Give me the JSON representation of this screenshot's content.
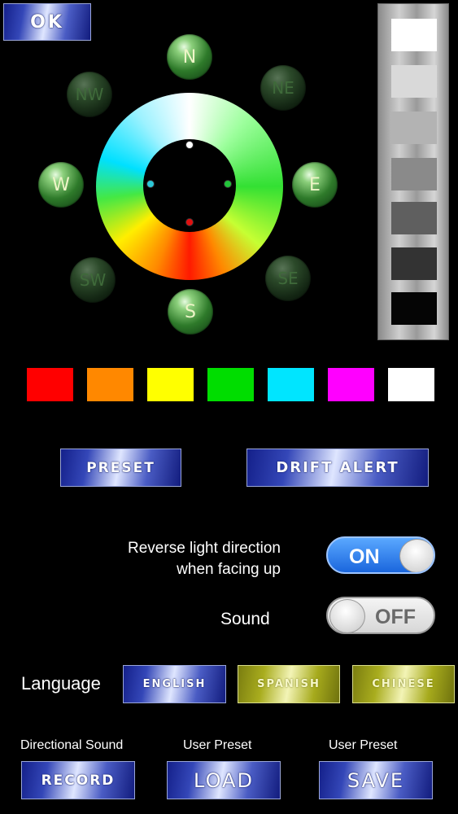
{
  "top": {
    "ok_label": "OK"
  },
  "compass": {
    "directions": {
      "n": "N",
      "ne": "NE",
      "e": "E",
      "se": "SE",
      "s": "S",
      "sw": "SW",
      "w": "W",
      "nw": "NW"
    }
  },
  "colors": {
    "grayscale": [
      "#ffffff",
      "#d9d9d9",
      "#b3b3b3",
      "#8a8a8a",
      "#5f5f5f",
      "#333333",
      "#050505"
    ],
    "palette": [
      "#ff0000",
      "#ff8800",
      "#ffff00",
      "#00dd00",
      "#00e5ff",
      "#ff00ff",
      "#ffffff"
    ]
  },
  "buttons": {
    "preset": "PRESET",
    "drift_alert": "DRIFT ALERT"
  },
  "settings": {
    "reverse_label_line1": "Reverse light direction",
    "reverse_label_line2": "when facing up",
    "reverse_state": "ON",
    "sound_label": "Sound",
    "sound_state": "OFF"
  },
  "language": {
    "label": "Language",
    "options": [
      "ENGLISH",
      "SPANISH",
      "CHINESE"
    ],
    "selected": "ENGLISH"
  },
  "bottom": {
    "directional_sound_label": "Directional Sound",
    "user_preset_load_label": "User Preset",
    "user_preset_save_label": "User Preset",
    "record": "RECORD",
    "load": "LOAD",
    "save": "SAVE"
  }
}
